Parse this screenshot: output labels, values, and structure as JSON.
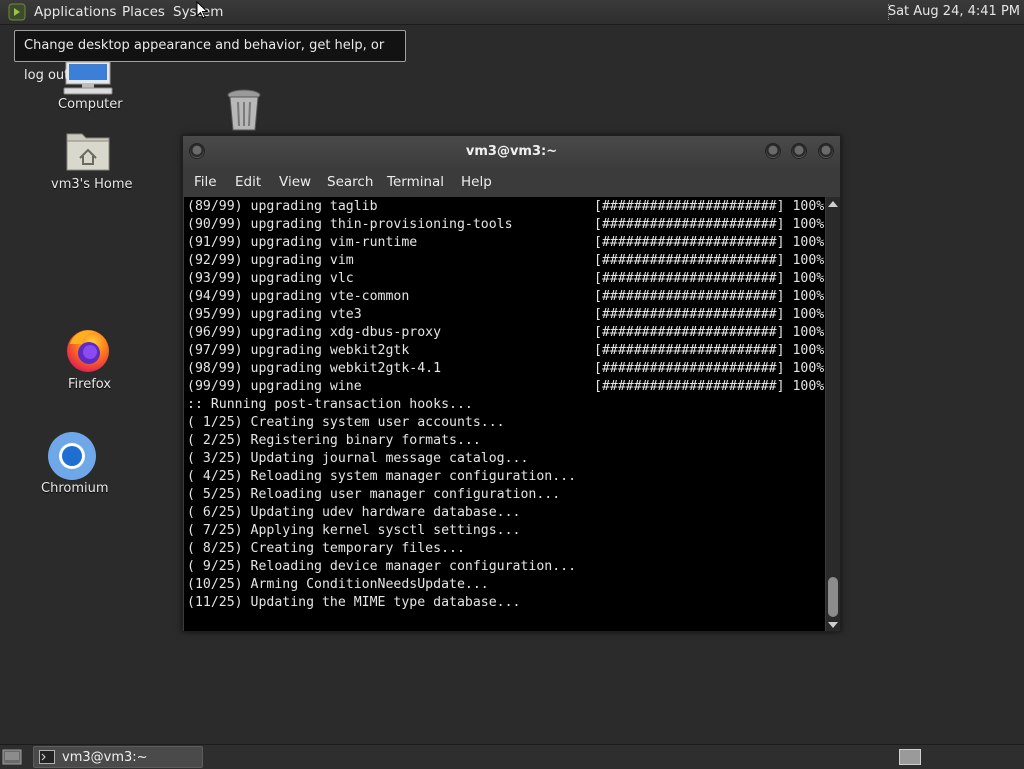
{
  "top_panel": {
    "menus": [
      "Applications",
      "Places",
      "System"
    ],
    "clock": "Sat Aug 24,  4:41 PM"
  },
  "tooltip": {
    "text": "Change desktop appearance and behavior, get help, or log out"
  },
  "desktop": {
    "icons": {
      "computer": "Computer",
      "home": "vm3's Home",
      "trash": "",
      "firefox": "Firefox",
      "chromium": "Chromium"
    }
  },
  "terminal": {
    "title": "vm3@vm3:~",
    "menu": [
      "File",
      "Edit",
      "View",
      "Search",
      "Terminal",
      "Help"
    ],
    "upgrade_lines": [
      {
        "text": "(89/99) upgrading taglib",
        "progress": "[######################] 100%"
      },
      {
        "text": "(90/99) upgrading thin-provisioning-tools",
        "progress": "[######################] 100%"
      },
      {
        "text": "(91/99) upgrading vim-runtime",
        "progress": "[######################] 100%"
      },
      {
        "text": "(92/99) upgrading vim",
        "progress": "[######################] 100%"
      },
      {
        "text": "(93/99) upgrading vlc",
        "progress": "[######################] 100%"
      },
      {
        "text": "(94/99) upgrading vte-common",
        "progress": "[######################] 100%"
      },
      {
        "text": "(95/99) upgrading vte3",
        "progress": "[######################] 100%"
      },
      {
        "text": "(96/99) upgrading xdg-dbus-proxy",
        "progress": "[######################] 100%"
      },
      {
        "text": "(97/99) upgrading webkit2gtk",
        "progress": "[######################] 100%"
      },
      {
        "text": "(98/99) upgrading webkit2gtk-4.1",
        "progress": "[######################] 100%"
      },
      {
        "text": "(99/99) upgrading wine",
        "progress": "[######################] 100%"
      }
    ],
    "hook_lines": [
      ":: Running post-transaction hooks...",
      "( 1/25) Creating system user accounts...",
      "( 2/25) Registering binary formats...",
      "( 3/25) Updating journal message catalog...",
      "( 4/25) Reloading system manager configuration...",
      "( 5/25) Reloading user manager configuration...",
      "( 6/25) Updating udev hardware database...",
      "( 7/25) Applying kernel sysctl settings...",
      "( 8/25) Creating temporary files...",
      "( 9/25) Reloading device manager configuration...",
      "(10/25) Arming ConditionNeedsUpdate...",
      "(11/25) Updating the MIME type database..."
    ]
  },
  "taskbar": {
    "window_label": "vm3@vm3:~"
  }
}
